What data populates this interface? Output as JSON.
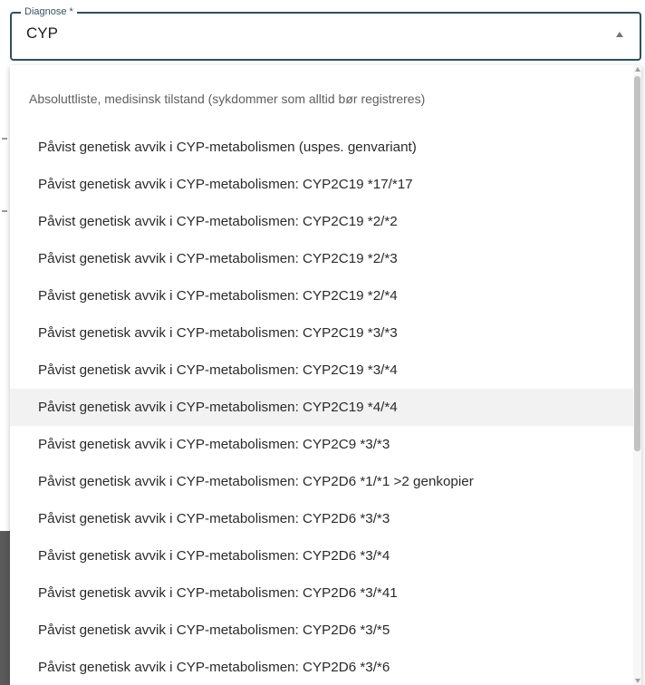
{
  "field": {
    "label": "Diagnose *",
    "value": "CYP",
    "toggle_icon": "arrow-up-icon"
  },
  "listbox": {
    "group_header": "Absoluttliste, medisinsk tilstand (sykdommer som alltid bør registreres)",
    "highlighted_index": 7,
    "options": [
      "Påvist genetisk avvik i CYP-metabolismen (uspes. genvariant)",
      "Påvist genetisk avvik i CYP-metabolismen: CYP2C19 *17/*17",
      "Påvist genetisk avvik i CYP-metabolismen: CYP2C19 *2/*2",
      "Påvist genetisk avvik i CYP-metabolismen: CYP2C19 *2/*3",
      "Påvist genetisk avvik i CYP-metabolismen: CYP2C19 *2/*4",
      "Påvist genetisk avvik i CYP-metabolismen: CYP2C19 *3/*3",
      "Påvist genetisk avvik i CYP-metabolismen: CYP2C19 *3/*4",
      "Påvist genetisk avvik i CYP-metabolismen: CYP2C19 *4/*4",
      "Påvist genetisk avvik i CYP-metabolismen: CYP2C9 *3/*3",
      "Påvist genetisk avvik i CYP-metabolismen: CYP2D6 *1/*1 >2 genkopier",
      "Påvist genetisk avvik i CYP-metabolismen: CYP2D6 *3/*3",
      "Påvist genetisk avvik i CYP-metabolismen: CYP2D6 *3/*4",
      "Påvist genetisk avvik i CYP-metabolismen: CYP2D6 *3/*41",
      "Påvist genetisk avvik i CYP-metabolismen: CYP2D6 *3/*5",
      "Påvist genetisk avvik i CYP-metabolismen: CYP2D6 *3/*6"
    ]
  },
  "colors": {
    "field_border": "#2f4f5f",
    "highlight_bg": "#f2f2f2",
    "text": "#2a2a2a",
    "header_text": "#5f5f5f"
  }
}
